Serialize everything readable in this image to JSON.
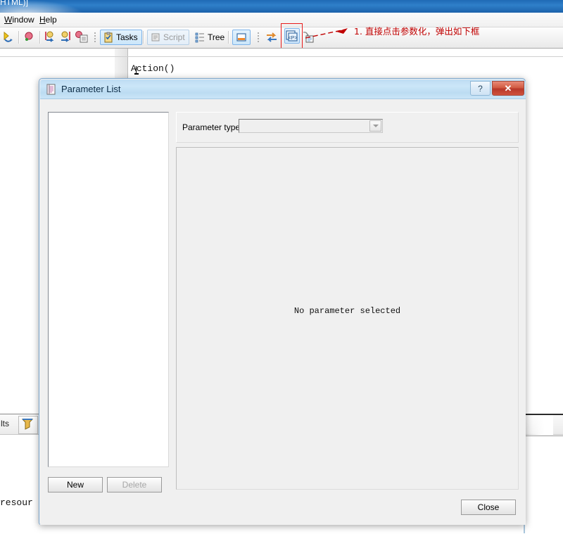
{
  "app": {
    "titlebar_text": "HTML)]",
    "menu": [
      {
        "label": "Window",
        "accel": "W"
      },
      {
        "label": "Help",
        "accel": "H"
      }
    ],
    "toolbar": {
      "icons": [
        {
          "name": "run-icon"
        },
        {
          "name": "stop-record-icon"
        },
        {
          "name": "step-into-icon"
        },
        {
          "name": "step-out-icon"
        },
        {
          "name": "object-repository-icon"
        }
      ],
      "toggles": [
        {
          "label": "Tasks",
          "state": "on",
          "icon": "tasks-icon"
        },
        {
          "label": "Script",
          "state": "off",
          "icon": "script-icon"
        },
        {
          "label": "Tree",
          "state": "plain",
          "icon": "tree-icon"
        }
      ],
      "keyword_view_label": "",
      "parameterize_icon_label": "<P>",
      "step_generator_icon": "step-generator-icon"
    },
    "annotation": "1. 直接点击参数化，弹出如下框",
    "code_line": "Action()",
    "lower_panel_tab_label": "lts",
    "lower_panel_text": "resour"
  },
  "dialog": {
    "title": "Parameter List",
    "help_button_label": "?",
    "close_button_label": "✕",
    "parameter_type_label": "Parameter type:",
    "parameter_type_value": "",
    "detail_empty_text": "No parameter selected",
    "buttons": {
      "new": "New",
      "delete": "Delete",
      "close": "Close"
    },
    "list_items": []
  },
  "colors": {
    "accent_blue": "#7eb4ea",
    "dialog_title": "#bedcf3",
    "annotation_red": "#c00000",
    "highlight_box_red": "#e81b1b",
    "close_button_red": "#c74a34"
  }
}
